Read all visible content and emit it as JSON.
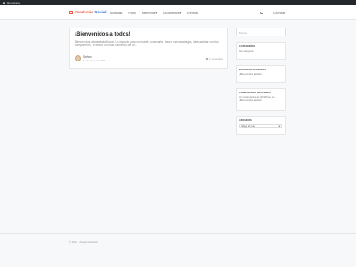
{
  "admin_bar": {
    "label": "Registrarse"
  },
  "header": {
    "logo_part1": "Academia",
    "logo_part2": "Social",
    "nav": [
      "Actividad",
      "Foros",
      "Miembros",
      "Documentos",
      "Eventos"
    ],
    "nav_dropdown_markers": [
      "",
      "",
      "▾",
      "▾",
      ""
    ],
    "login_label": "Conectar"
  },
  "post": {
    "title": "¡Bienvenidos a todos!",
    "excerpt": "Bienvenidos a AcademiaSocial. Un espacio para compartir, conectarte, hacer nuevos amigos, intercambiar con tus compañeros. Te deseo un lindo comienzo de añ...",
    "author": "Stefan",
    "date": "14 de mayo de 2021",
    "comments": "1 comentario"
  },
  "sidebar": {
    "search_placeholder": "Buscar...",
    "categories": {
      "title": "CATEGORÍAS",
      "item": "Sin categoría"
    },
    "recent_posts": {
      "title": "ENTRADAS RECIENTES",
      "item": "¡Bienvenidos a todos!"
    },
    "recent_comments": {
      "title": "COMENTARIOS RECIENTES",
      "item": "Un comentarista de WordPress en ¡Bienvenidos a todos!"
    },
    "archives": {
      "title": "ARCHIVOS",
      "select_value": "Elegir el mes"
    }
  },
  "footer": {
    "copyright": "© 2023 · AcademiaSocial"
  },
  "colors": {
    "brand_orange": "#e8553a",
    "brand_blue": "#2a6fd6",
    "admin_bar": "#23282d"
  }
}
